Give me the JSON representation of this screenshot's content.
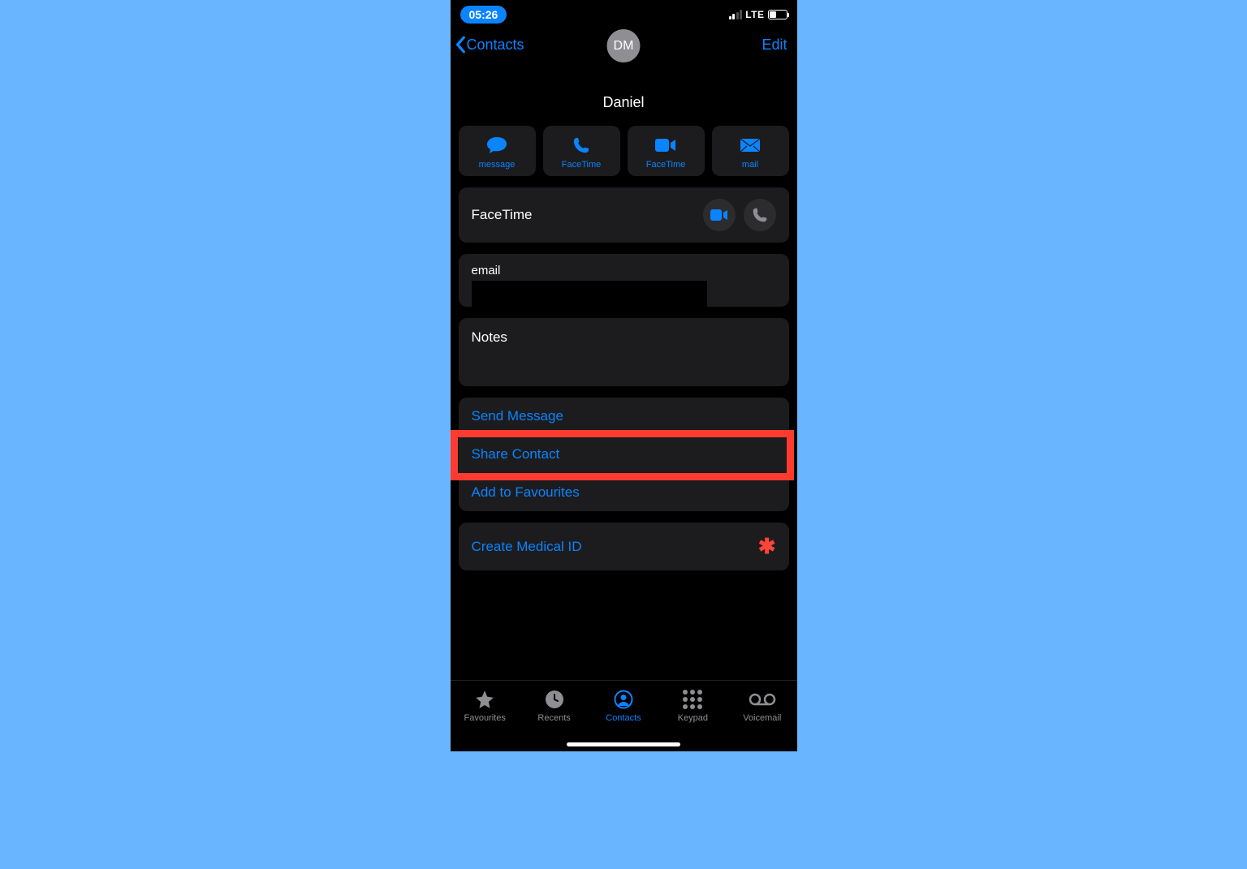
{
  "status": {
    "time": "05:26",
    "network": "LTE"
  },
  "nav": {
    "back_label": "Contacts",
    "edit_label": "Edit"
  },
  "contact": {
    "initials": "DM",
    "name": "Daniel"
  },
  "actions": {
    "message": "message",
    "facetime_video": "FaceTime",
    "facetime_audio": "FaceTime",
    "mail": "mail"
  },
  "facetime_section": {
    "label": "FaceTime"
  },
  "email_section": {
    "label": "email"
  },
  "notes_section": {
    "label": "Notes"
  },
  "list": {
    "send_message": "Send Message",
    "share_contact": "Share Contact",
    "add_favourites": "Add to Favourites"
  },
  "medical": {
    "label": "Create Medical ID"
  },
  "tabs": {
    "favourites": "Favourites",
    "recents": "Recents",
    "contacts": "Contacts",
    "keypad": "Keypad",
    "voicemail": "Voicemail"
  },
  "colors": {
    "accent": "#0a84ff",
    "danger": "#ff3b30"
  }
}
